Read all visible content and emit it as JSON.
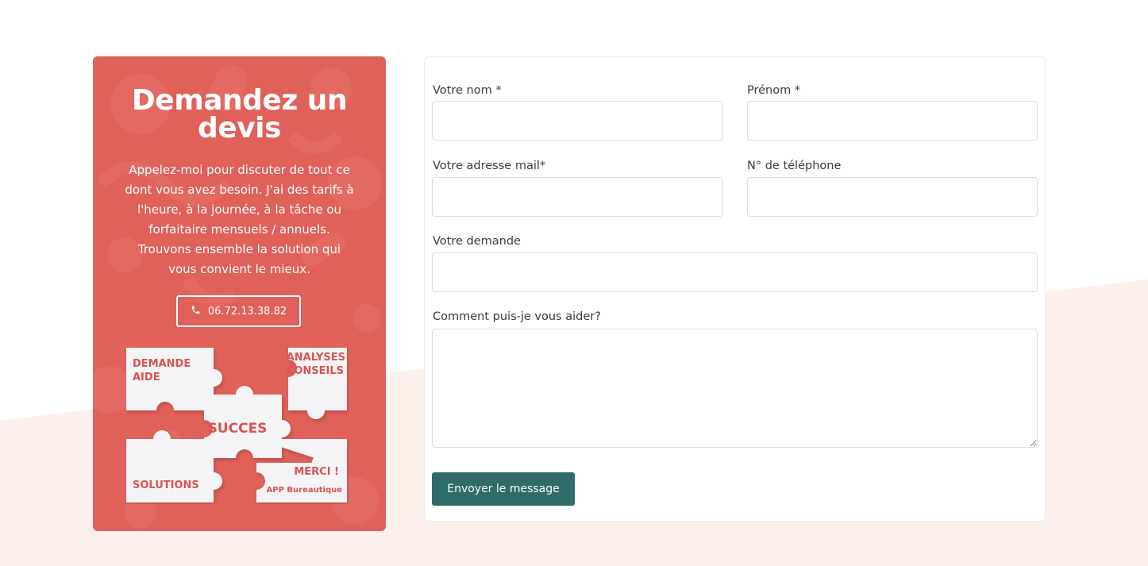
{
  "colors": {
    "accent_red": "#e0605a",
    "button_teal": "#2f6b68",
    "band_pink": "#fdf0ec"
  },
  "promo": {
    "title": "Demandez un devis",
    "text": "Appelez-moi pour discuter de tout ce dont vous avez besoin. J'ai des tarifs à l'heure, à la journée, à la tâche ou forfaitaire mensuels / annuels. Trouvons ensemble la solution qui vous convient le mieux.",
    "phone_icon": "phone-icon",
    "phone": "06.72.13.38.82",
    "puzzle": {
      "piece_demande_line1": "DEMANDE",
      "piece_demande_line2": "AIDE",
      "piece_analyses_line1": "ANALYSES",
      "piece_analyses_line2": "CONSEILS",
      "piece_succes": "SUCCES",
      "piece_solutions": "SOLUTIONS",
      "piece_merci": "MERCI !",
      "brand": "APP  Bureautique"
    }
  },
  "form": {
    "nom_label": "Votre nom *",
    "prenom_label": "Prénom *",
    "email_label": "Votre adresse mail*",
    "phone_label": "N° de téléphone",
    "demande_label": "Votre demande",
    "message_label": "Comment puis-je vous aider?",
    "nom_value": "",
    "prenom_value": "",
    "email_value": "",
    "phone_value": "",
    "demande_value": "",
    "message_value": "",
    "submit_label": "Envoyer le message"
  }
}
